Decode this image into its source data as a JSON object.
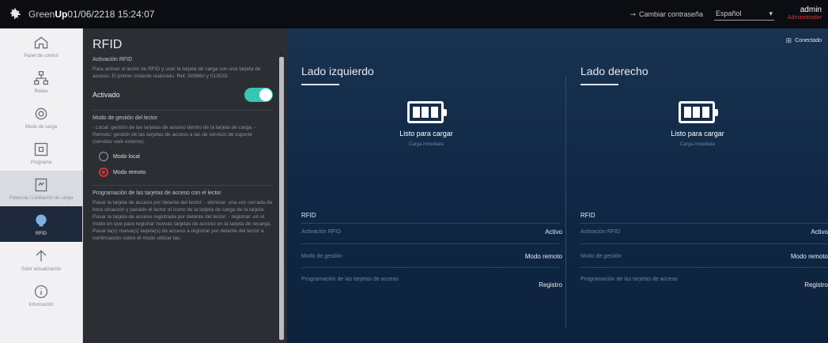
{
  "topbar": {
    "brand_prefix": "Green",
    "brand_suffix": "Up",
    "datetime": "01/06/2218 15:24:07",
    "change_password": "Cambiar contraseña",
    "language": "Español",
    "user_name": "admin",
    "user_role": "Administrador"
  },
  "nav": {
    "items": [
      {
        "label": "Panel de control",
        "icon": "home-icon"
      },
      {
        "label": "Redes",
        "icon": "network-icon"
      },
      {
        "label": "Modo de carga",
        "icon": "gear-icon"
      },
      {
        "label": "Programa",
        "icon": "schedule-icon"
      },
      {
        "label": "Potencia / Limitación de carga",
        "icon": "power-limit-icon"
      },
      {
        "label": "RFID",
        "icon": "rfid-icon"
      },
      {
        "label": "Subir actualización",
        "icon": "upload-icon"
      },
      {
        "label": "Información",
        "icon": "info-icon"
      }
    ]
  },
  "panel": {
    "title": "RFID",
    "activation_head": "Activación RFID",
    "activation_text": "Para activar el lector de RFID y usar la tarjeta de carga con una tarjeta de acceso. El primer instante realizado. Ref. 009860 y 013533.",
    "activated_label": "Activado",
    "mode_head": "Modo de gestión del lector",
    "mode_text": "- Local: gestión de las tarjetas de acceso dentro de la tarjeta de carga. - Remoto: gestión de las tarjetas de acceso a las de servicio de soporte (servidor web externo).",
    "mode_local": "Modo local",
    "mode_remote": "Modo remoto",
    "prog_head": "Programación de las tarjetas de acceso con el lector",
    "prog_text": "Pasar la tarjeta de acceso por delante del lector: - eliminar: una vez cerrada de hora situación y pasado el lector el icono de la tarjeta de carga de la tarjeta. Pasar la tarjeta de acceso registrada por delante del lector. - registrar: en el modo en que para registrar nuevas tarjetas de acceso en la tarjeta de recarga. Pasar la(s) nueva(s) tarjeta(s) de acceso a registrar por delante del lector a continuación sobre el modo utilizar las."
  },
  "main": {
    "connection": "Conectado",
    "left": {
      "title": "Lado izquierdo",
      "status": "Listo para cargar",
      "substatus": "Carga inmediata",
      "rfid_head": "RFID",
      "rows": [
        {
          "key": "Activación RFID",
          "value": "Activo"
        },
        {
          "key": "Modo de gestión",
          "value": "Modo remoto"
        },
        {
          "key": "Programación de las tarjetas de acceso",
          "value": "Registro"
        }
      ]
    },
    "right": {
      "title": "Lado derecho",
      "status": "Listo para cargar",
      "substatus": "Carga inmediata",
      "rfid_head": "RFID",
      "rows": [
        {
          "key": "Activación RFID",
          "value": "Activo"
        },
        {
          "key": "Modo de gestión",
          "value": "Modo remoto"
        },
        {
          "key": "Programación de las tarjetas de acceso",
          "value": "Registro"
        }
      ]
    }
  },
  "colors": {
    "accent_toggle": "#36c6b6",
    "radio_selected": "#e0312d",
    "topbar_bg": "#0b0d12",
    "main_bg": "#0f2744"
  }
}
